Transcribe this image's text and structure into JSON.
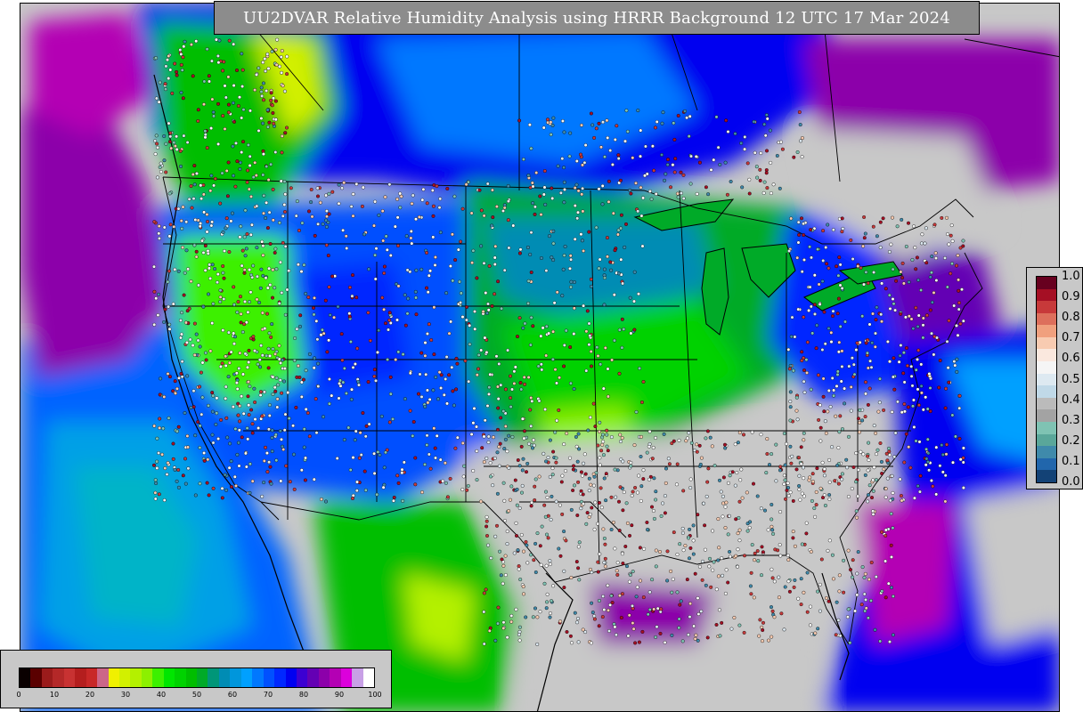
{
  "title": "UU2DVAR Relative Humidity Analysis using HRRR Background 12 UTC 17 Mar 2024",
  "obs_colorbar": {
    "ticks": [
      "1.0",
      "0.9",
      "0.8",
      "0.7",
      "0.6",
      "0.5",
      "0.4",
      "0.3",
      "0.2",
      "0.1",
      "0.0"
    ],
    "colors": [
      "#67001f",
      "#a50f24",
      "#c7393a",
      "#dd6f5c",
      "#f0a07e",
      "#f8cbb1",
      "#fae8de",
      "#f5f5f5",
      "#dde9f1",
      "#c0d9e8",
      "#bbbbbb",
      "#a3a3a3",
      "#7fc3b3",
      "#5aa79a",
      "#3f8aab",
      "#2166ac",
      "#134276"
    ]
  },
  "rh_colorbar": {
    "ticks": [
      "0",
      "10",
      "20",
      "30",
      "40",
      "50",
      "60",
      "70",
      "80",
      "90",
      "100"
    ],
    "colors": [
      "#0a0000",
      "#5a0000",
      "#9b1b1b",
      "#b42828",
      "#c83232",
      "#b41e1e",
      "#c82828",
      "#cc6688",
      "#f0f000",
      "#d2f000",
      "#b4f000",
      "#8cf000",
      "#3cf000",
      "#00e600",
      "#00d200",
      "#00be00",
      "#00aa28",
      "#009678",
      "#008cb4",
      "#0096dc",
      "#00a0ff",
      "#0078ff",
      "#0050ff",
      "#0028ff",
      "#0000f0",
      "#3c00d2",
      "#6400b4",
      "#8c00aa",
      "#b400b4",
      "#dc00dc",
      "#c8a0e6",
      "#ffffff"
    ]
  }
}
